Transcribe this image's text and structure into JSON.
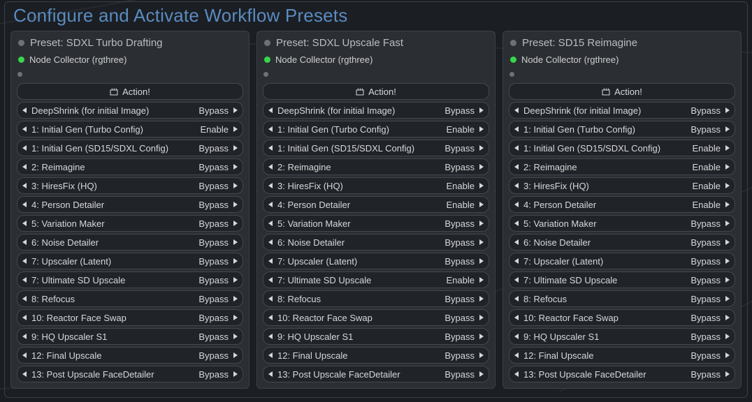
{
  "title": "Configure and Activate Workflow Presets",
  "collector_label": "Node Collector (rgthree)",
  "action_label": "Action!",
  "panels": [
    {
      "title": "Preset: SDXL Turbo Drafting",
      "rows": [
        {
          "label": "DeepShrink (for initial Image)",
          "value": "Bypass"
        },
        {
          "label": "1: Initial Gen (Turbo Config)",
          "value": "Enable"
        },
        {
          "label": "1: Initial Gen (SD15/SDXL Config)",
          "value": "Bypass"
        },
        {
          "label": "2: Reimagine",
          "value": "Bypass"
        },
        {
          "label": "3: HiresFix (HQ)",
          "value": "Bypass"
        },
        {
          "label": "4: Person Detailer",
          "value": "Bypass"
        },
        {
          "label": "5: Variation Maker",
          "value": "Bypass"
        },
        {
          "label": "6: Noise Detailer",
          "value": "Bypass"
        },
        {
          "label": "7: Upscaler (Latent)",
          "value": "Bypass"
        },
        {
          "label": "7: Ultimate SD Upscale",
          "value": "Bypass"
        },
        {
          "label": "8: Refocus",
          "value": "Bypass"
        },
        {
          "label": "10: Reactor Face Swap",
          "value": "Bypass"
        },
        {
          "label": "9: HQ Upscaler S1",
          "value": "Bypass"
        },
        {
          "label": "12: Final Upscale",
          "value": "Bypass"
        },
        {
          "label": "13: Post Upscale FaceDetailer",
          "value": "Bypass"
        }
      ]
    },
    {
      "title": "Preset: SDXL Upscale Fast",
      "rows": [
        {
          "label": "DeepShrink (for initial Image)",
          "value": "Bypass"
        },
        {
          "label": "1: Initial Gen (Turbo Config)",
          "value": "Enable"
        },
        {
          "label": "1: Initial Gen (SD15/SDXL Config)",
          "value": "Bypass"
        },
        {
          "label": "2: Reimagine",
          "value": "Bypass"
        },
        {
          "label": "3: HiresFix (HQ)",
          "value": "Enable"
        },
        {
          "label": "4: Person Detailer",
          "value": "Enable"
        },
        {
          "label": "5: Variation Maker",
          "value": "Bypass"
        },
        {
          "label": "6: Noise Detailer",
          "value": "Bypass"
        },
        {
          "label": "7: Upscaler (Latent)",
          "value": "Bypass"
        },
        {
          "label": "7: Ultimate SD Upscale",
          "value": "Enable"
        },
        {
          "label": "8: Refocus",
          "value": "Bypass"
        },
        {
          "label": "10: Reactor Face Swap",
          "value": "Bypass"
        },
        {
          "label": "9: HQ Upscaler S1",
          "value": "Bypass"
        },
        {
          "label": "12: Final Upscale",
          "value": "Bypass"
        },
        {
          "label": "13: Post Upscale FaceDetailer",
          "value": "Bypass"
        }
      ]
    },
    {
      "title": "Preset: SD15 Reimagine",
      "rows": [
        {
          "label": "DeepShrink (for initial Image)",
          "value": "Bypass"
        },
        {
          "label": "1: Initial Gen (Turbo Config)",
          "value": "Bypass"
        },
        {
          "label": "1: Initial Gen (SD15/SDXL Config)",
          "value": "Enable"
        },
        {
          "label": "2: Reimagine",
          "value": "Enable"
        },
        {
          "label": "3: HiresFix (HQ)",
          "value": "Enable"
        },
        {
          "label": "4: Person Detailer",
          "value": "Enable"
        },
        {
          "label": "5: Variation Maker",
          "value": "Bypass"
        },
        {
          "label": "6: Noise Detailer",
          "value": "Bypass"
        },
        {
          "label": "7: Upscaler (Latent)",
          "value": "Bypass"
        },
        {
          "label": "7: Ultimate SD Upscale",
          "value": "Bypass"
        },
        {
          "label": "8: Refocus",
          "value": "Bypass"
        },
        {
          "label": "10: Reactor Face Swap",
          "value": "Bypass"
        },
        {
          "label": "9: HQ Upscaler S1",
          "value": "Bypass"
        },
        {
          "label": "12: Final Upscale",
          "value": "Bypass"
        },
        {
          "label": "13: Post Upscale FaceDetailer",
          "value": "Bypass"
        }
      ]
    }
  ]
}
